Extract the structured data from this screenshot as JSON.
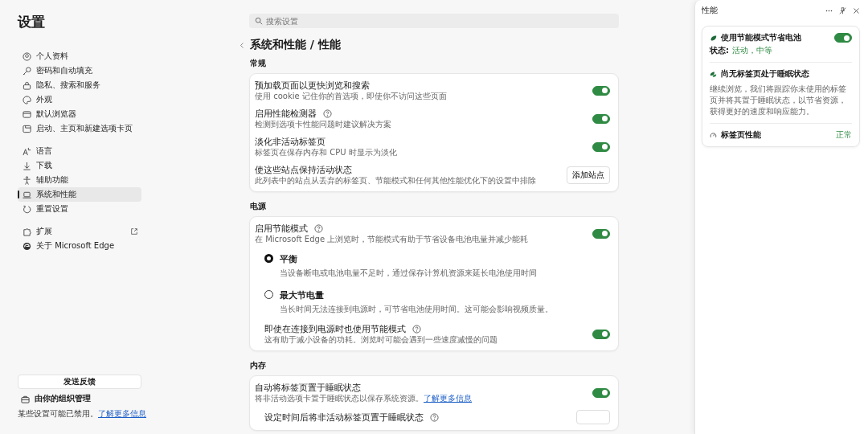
{
  "sidebar": {
    "title": "设置",
    "groups": [
      {
        "items": [
          {
            "label": "个人资料",
            "selected": false,
            "external_link": false
          },
          {
            "label": "密码和自动填充",
            "selected": false,
            "external_link": false
          },
          {
            "label": "隐私、搜索和服务",
            "selected": false,
            "external_link": false
          },
          {
            "label": "外观",
            "selected": false,
            "external_link": false
          },
          {
            "label": "默认浏览器",
            "selected": false,
            "external_link": false
          },
          {
            "label": "启动、主页和新建选项卡页",
            "selected": false,
            "external_link": false
          }
        ]
      },
      {
        "items": [
          {
            "label": "语言",
            "selected": false,
            "external_link": false
          },
          {
            "label": "下载",
            "selected": false,
            "external_link": false
          },
          {
            "label": "辅助功能",
            "selected": false,
            "external_link": false
          },
          {
            "label": "系统和性能",
            "selected": true,
            "external_link": false
          },
          {
            "label": "重置设置",
            "selected": false,
            "external_link": false
          }
        ]
      },
      {
        "items": [
          {
            "label": "扩展",
            "selected": false,
            "external_link": true
          },
          {
            "label": "关于 Microsoft Edge",
            "selected": false,
            "external_link": false
          }
        ]
      }
    ],
    "feedback_button": "发送反馈",
    "managed": "由你的组织管理",
    "note": {
      "text": "某些设置可能已禁用。",
      "link": "了解更多信息"
    }
  },
  "main": {
    "search": {
      "placeholder": "搜索设置"
    },
    "title": "系统和性能 / 性能",
    "sections": [
      {
        "title": "常规",
        "rows": [
          {
            "kind": "toggle",
            "label": "预加载页面以更快浏览和搜索",
            "description": "使用 cookie 记住你的首选项，即使你不访问这些页面",
            "help": false,
            "on": true
          },
          {
            "kind": "toggle",
            "label": "启用性能检测器",
            "description": "检测到选项卡性能问题时建议解决方案",
            "help": true,
            "on": true
          },
          {
            "kind": "toggle",
            "label": "淡化非活动标签页",
            "description": "标签页在保存内存和 CPU 时显示为淡化",
            "help": false,
            "on": true
          },
          {
            "kind": "button",
            "label": "使这些站点保持活动状态",
            "description": "此列表中的站点从丢弃的标签页、节能模式和任何其他性能优化下的设置中排除",
            "button": "添加站点"
          }
        ]
      },
      {
        "title": "电源",
        "rows": [
          {
            "kind": "toggle",
            "label": "启用节能模式",
            "description": "在 Microsoft Edge 上浏览时，节能模式有助于节省设备电池电量并减少能耗",
            "help": true,
            "on": true,
            "children": [
              {
                "kind": "radio",
                "label": "平衡",
                "description": "当设备断电或电池电量不足时，通过保存计算机资源来延长电池使用时间",
                "selected": true
              },
              {
                "kind": "radio",
                "label": "最大节电量",
                "description": "当长时间无法连接到电源时，可节省电池使用时间。这可能会影响视频质量。",
                "selected": false
              },
              {
                "kind": "toggle",
                "label": "即使在连接到电源时也使用节能模式",
                "description": "这有助于减小设备的功耗。浏览时可能会遇到一些速度减慢的问题",
                "help": true,
                "on": true
              }
            ]
          }
        ]
      },
      {
        "title": "内存",
        "rows": [
          {
            "kind": "toggle",
            "label": "自动将标签页置于睡眠状态",
            "description": "将非活动选项卡置于睡眠状态以保存系统资源。",
            "link": "了解更多信息",
            "help": false,
            "on": true,
            "children": [
              {
                "kind": "select",
                "label": "设定时间后将非活动标签页置于睡眠状态",
                "help": true
              }
            ]
          }
        ]
      }
    ]
  },
  "panel": {
    "title": "性能",
    "battery": {
      "label": "使用节能模式节省电池",
      "on": true,
      "status_label": "状态:",
      "status": "活动，中等"
    },
    "sleep": {
      "label": "尚无标签页处于睡眠状态",
      "description": "继续浏览，我们将跟踪你未使用的标签页并将其置于睡眠状态，以节省资源，获得更好的速度和响应能力。"
    },
    "tab_performance": {
      "label": "标签页性能",
      "value": "正常"
    }
  }
}
